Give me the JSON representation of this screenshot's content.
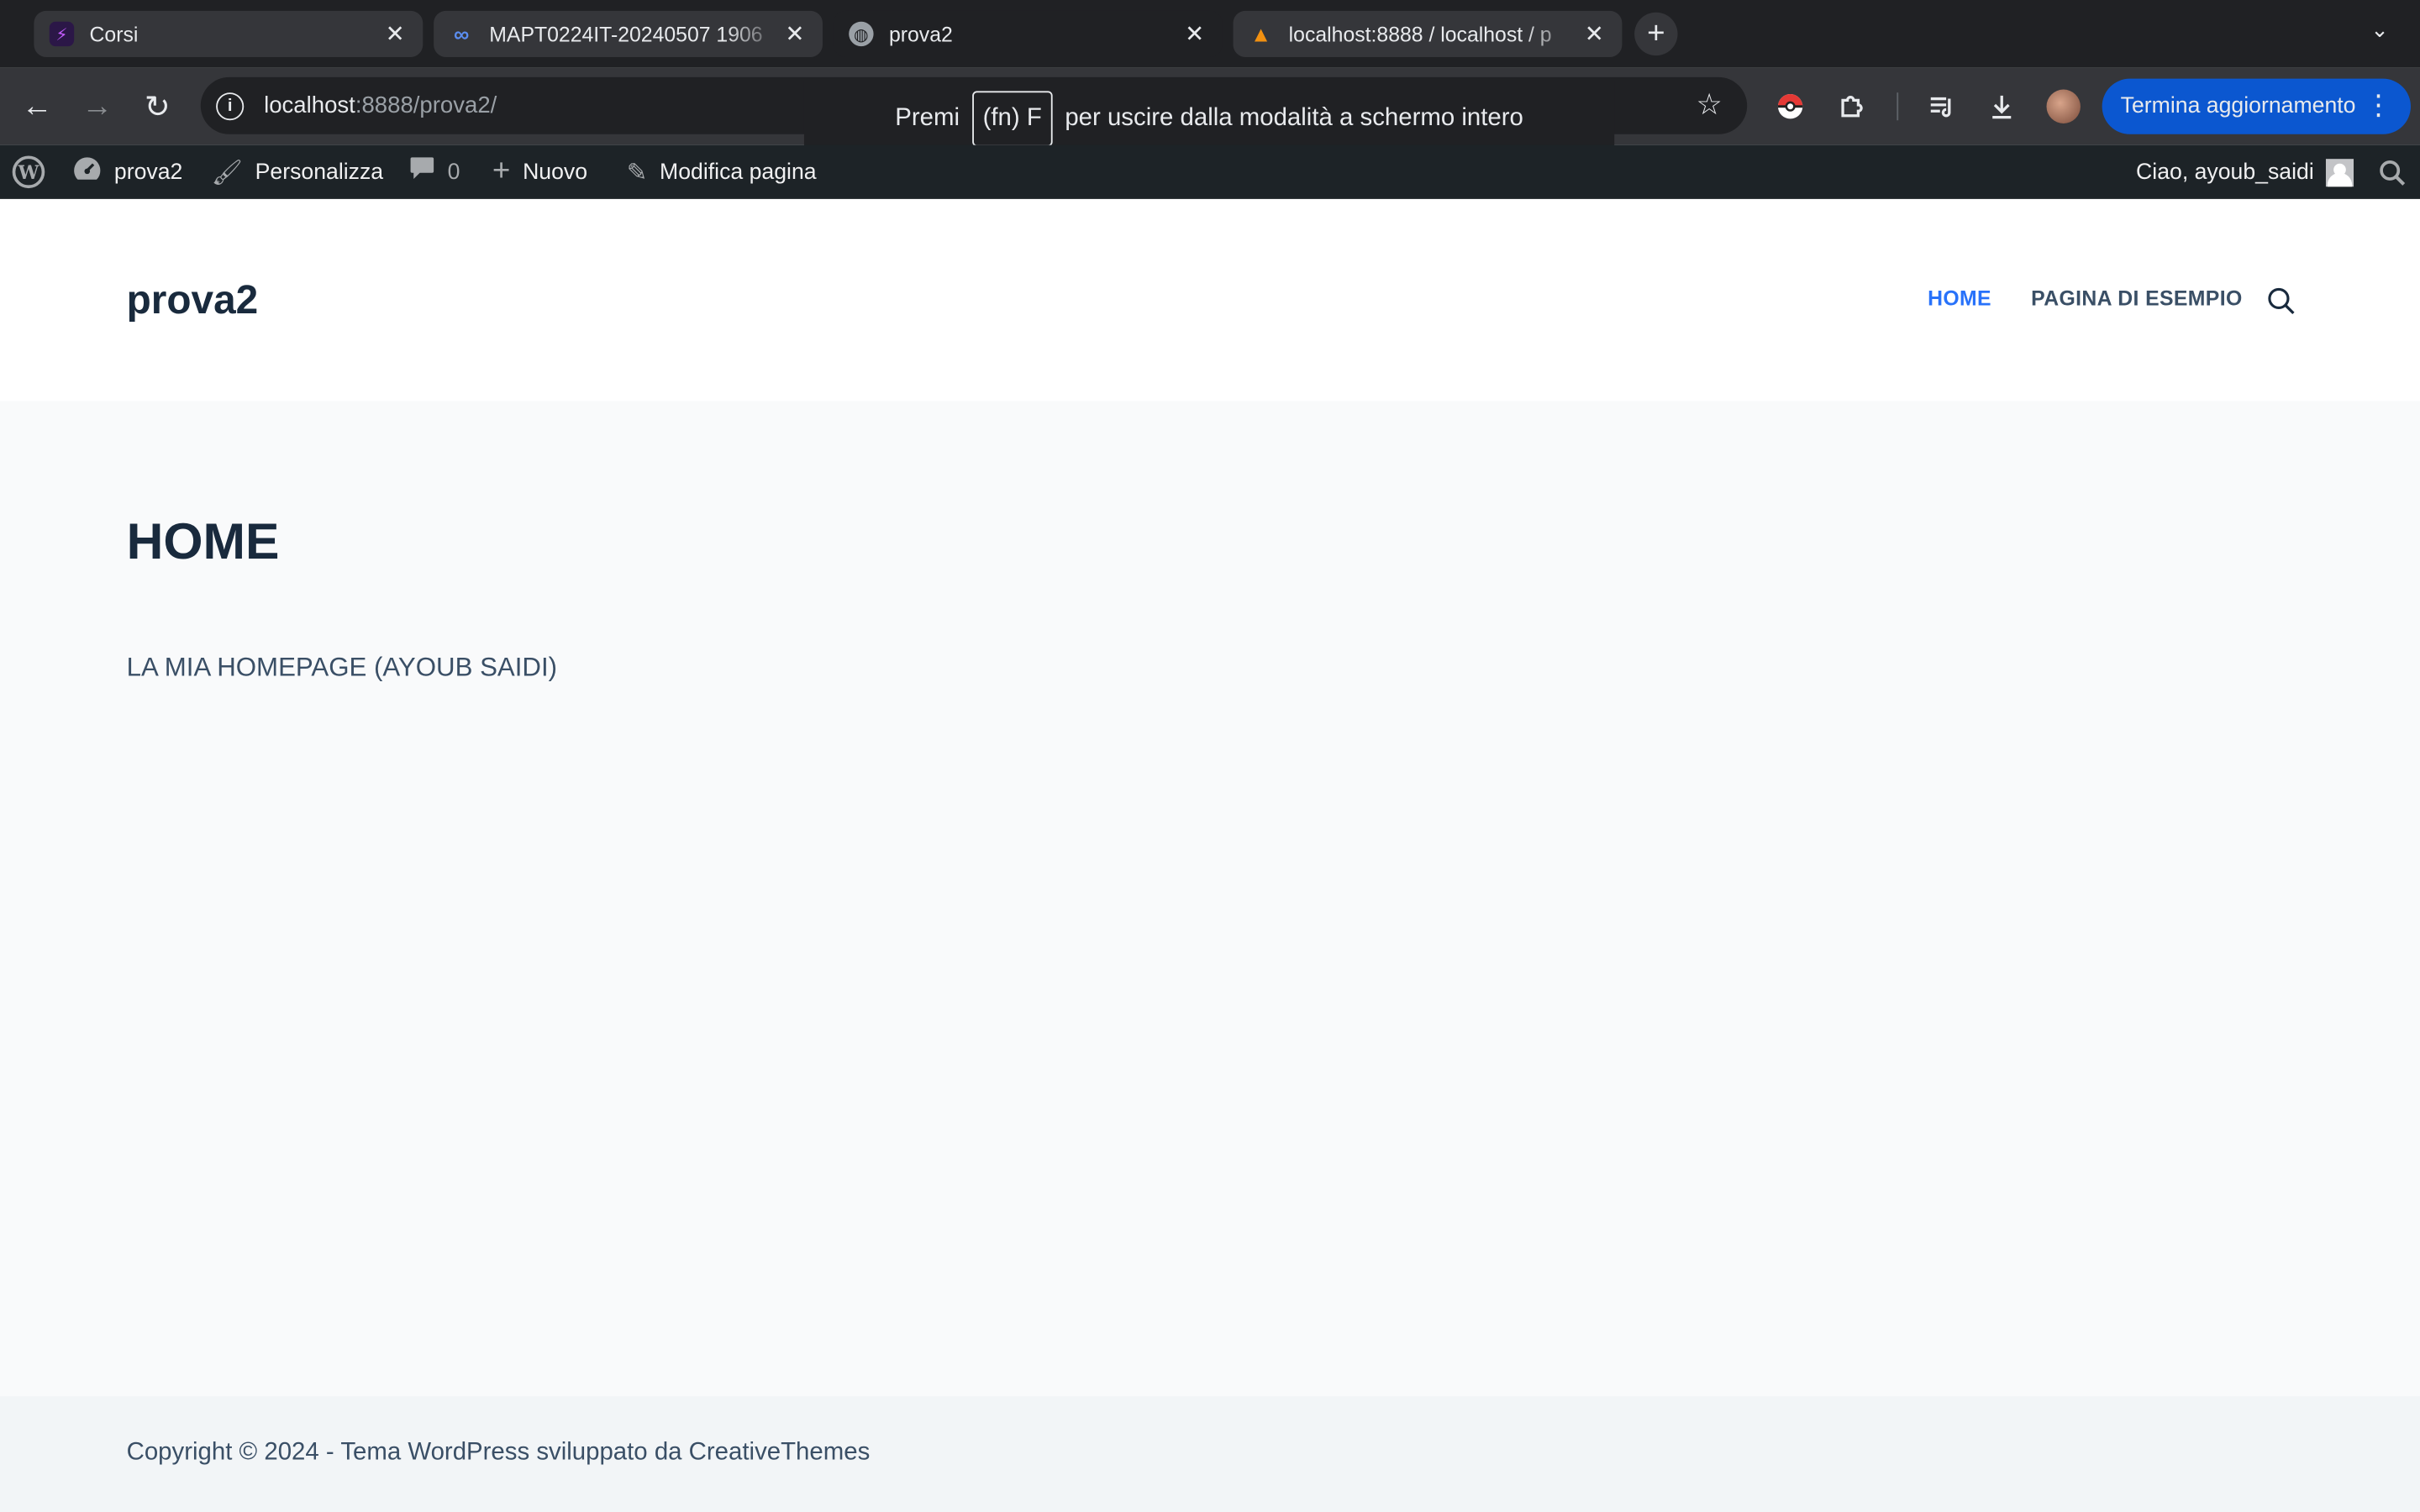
{
  "browser": {
    "tabs": [
      {
        "title": "Corsi",
        "icon": "corsi-icon"
      },
      {
        "title": "MAPT0224IT-20240507 1906",
        "icon": "meeting-icon"
      },
      {
        "title": "prova2",
        "icon": "globe-icon",
        "active": true
      },
      {
        "title": "localhost:8888 / localhost / p",
        "icon": "phpmyadmin-icon"
      }
    ],
    "url_host": "localhost",
    "url_rest": ":8888/prova2/",
    "update_button": "Termina aggiornamento",
    "accent": "#0b57d0"
  },
  "toast": {
    "before": "Premi",
    "key": "(fn) F",
    "after": "per uscire dalla modalità a schermo intero"
  },
  "adminbar": {
    "site_name": "prova2",
    "customize": "Personalizza",
    "comments_count": "0",
    "new": "Nuovo",
    "edit_page": "Modifica pagina",
    "greeting": "Ciao, ayoub_saidi"
  },
  "site": {
    "title": "prova2",
    "menu": [
      {
        "label": "HOME",
        "current": true
      },
      {
        "label": "PAGINA DI ESEMPIO",
        "current": false
      }
    ],
    "accent": "#2872fa"
  },
  "page": {
    "title": "HOME",
    "body": "LA MIA HOMEPAGE (AYOUB SAIDI)"
  },
  "footer": {
    "copyright": "Copyright © 2024 - Tema WordPress sviluppato da CreativeThemes"
  }
}
